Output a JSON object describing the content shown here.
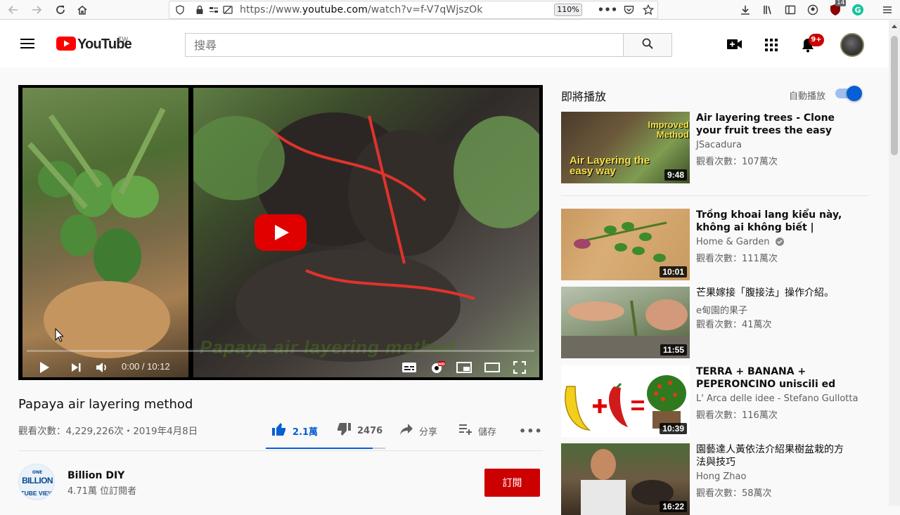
{
  "browser": {
    "url_prefix": "https://www.",
    "url_domain": "youtube.com",
    "url_path": "/watch?v=f-V7qWjszOk",
    "zoom": "110%",
    "ext_badge": "14"
  },
  "masthead": {
    "logo_text": "YouTube",
    "logo_region": "TW",
    "search_placeholder": "搜尋",
    "notification_count": "9+"
  },
  "player": {
    "overlay_text": "Papaya air layering method",
    "time": "0:00 / 10:12",
    "progress": 0
  },
  "video": {
    "title": "Papaya air layering method",
    "meta": "觀看次數：4,229,226次・2019年4月8日",
    "likes": "2.1萬",
    "dislikes": "2476",
    "share_label": "分享",
    "save_label": "儲存",
    "sentiment_ratio": 0.896
  },
  "channel": {
    "name": "Billion DIY",
    "subscribers": "4.71萬 位訂閱者",
    "subscribe_label": "訂閱",
    "avatar_text_top": "ONE",
    "avatar_text_main": "BILLION",
    "avatar_text_bottom": "TUBE VIEW"
  },
  "sidebar": {
    "upnext_label": "即將播放",
    "autoplay_label": "自動播放",
    "autoplay_on": true,
    "items": [
      {
        "title": "Air layering trees - Clone your fruit trees the easy way.",
        "channel": "JSacadura",
        "views": "觀看次數：107萬次",
        "duration": "9:48",
        "thumb_text_a": "Improved Method",
        "thumb_text_b": "Air Layering the easy way",
        "verified": false
      },
      {
        "title": "Trồng khoai lang kiểu này, không ai không biết | Growing...",
        "channel": "Home & Garden",
        "views": "觀看次數：111萬次",
        "duration": "10:01",
        "verified": true
      },
      {
        "title": "芒果嫁接「腹接法」操作介紹。",
        "channel": "e甸園的果子",
        "views": "觀看次數：41萬次",
        "duration": "11:55",
        "verified": false
      },
      {
        "title": "TERRA + BANANA + PEPERONCINO uniscili ed il...",
        "channel": "L' Arca delle idee - Stefano Gullotta",
        "views": "觀看次數：116萬次",
        "duration": "10:39",
        "verified": false
      },
      {
        "title": "園藝達人黃依法介紹果樹盆栽的方法與技巧",
        "channel": "Hong Zhao",
        "views": "觀看次數：58萬次",
        "duration": "16:22",
        "verified": false
      }
    ]
  },
  "colors": {
    "brand_red": "#ff0000",
    "subscribe_red": "#cc0000",
    "link_blue": "#065fd4"
  }
}
